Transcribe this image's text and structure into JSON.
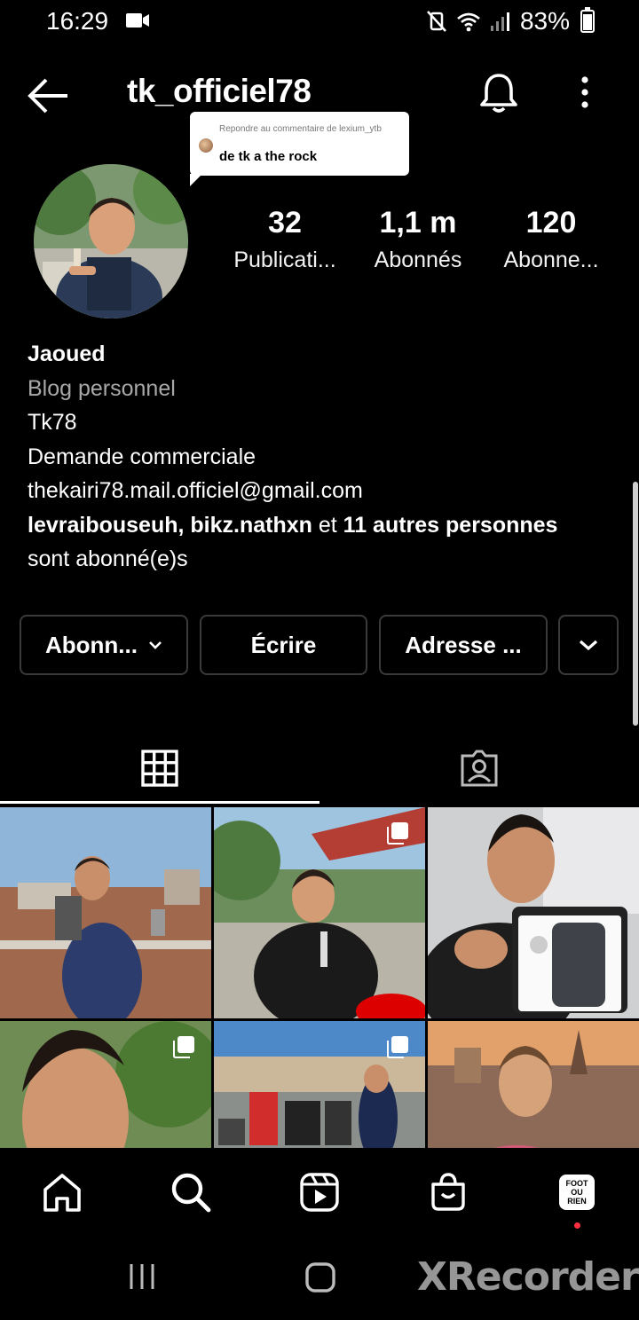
{
  "status_bar": {
    "time": "16:29",
    "battery": "83%",
    "battery_level": 0.83,
    "icons": [
      "video-record-icon",
      "mute-vibrate-icon",
      "wifi-icon",
      "signal-icon",
      "battery-icon"
    ]
  },
  "header": {
    "username": "tk_officiel78",
    "icons": [
      "back-arrow-icon",
      "bell-icon",
      "more-vertical-icon"
    ]
  },
  "reply_bubble": {
    "label": "Repondre au commentaire de lexium_ytb",
    "text": "de tk a the rock"
  },
  "stats": {
    "posts": {
      "value": "32",
      "label": "Publicati..."
    },
    "followers": {
      "value": "1,1 m",
      "label": "Abonnés"
    },
    "following": {
      "value": "120",
      "label": "Abonne..."
    }
  },
  "bio": {
    "name": "Jaoued",
    "category": "Blog personnel",
    "line1": "Tk78",
    "line2": "Demande commerciale",
    "email": "thekairi78.mail.officiel@gmail.com",
    "followed_by": {
      "user1": "levraibouseuh",
      "separator": ", ",
      "user2": "bikz.nathxn",
      "and_text": " et ",
      "others": "11 autres personnes",
      "suffix": "sont abonné(e)s"
    }
  },
  "actions": {
    "follow": "Abonn...",
    "message": "Écrire",
    "address": "Adresse ..."
  },
  "tabs": {
    "icons": [
      "grid-icon",
      "tagged-person-icon"
    ],
    "active": "grid"
  },
  "bottom_nav": {
    "profile_pill_lines": [
      "FOOT",
      "OU",
      "RIEN"
    ],
    "icons": [
      "home-icon",
      "search-icon",
      "reels-icon",
      "shop-icon"
    ]
  },
  "system_nav": {
    "watermark": "XRecorder"
  },
  "colors": {
    "background": "#000000",
    "text": "#ffffff",
    "muted": "#a8a8a8",
    "button_border": "#3a3a3a",
    "notification_dot": "#ff3040"
  }
}
